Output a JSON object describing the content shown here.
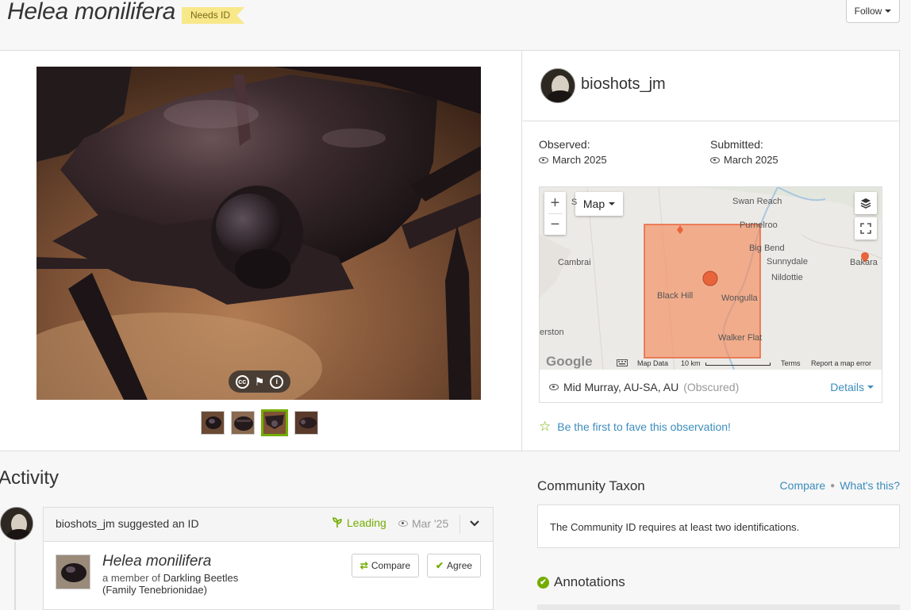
{
  "header": {
    "species": "Helea monilifera",
    "quality_badge": "Needs ID",
    "follow_label": "Follow"
  },
  "photo": {
    "thumbnails": 4,
    "active_thumbnail": 3
  },
  "observer": {
    "username": "bioshots_jm"
  },
  "dates": {
    "observed_label": "Observed:",
    "observed_value": "March 2025",
    "submitted_label": "Submitted:",
    "submitted_value": "March 2025"
  },
  "map": {
    "type_selector": "Map",
    "zoom_in": "+",
    "zoom_out": "−",
    "places": {
      "swan_reach": "Swan Reach",
      "purnelroo": "Purnelroo",
      "big_bend": "Big Bend",
      "cambrai": "Cambrai",
      "sunnydale": "Sunnydale",
      "nildottie": "Nildottie",
      "bakara": "Bakara",
      "black_hill": "Black Hill",
      "wongulla": "Wongulla",
      "walker_flat": "Walker Flat",
      "erston": "erston",
      "s_partial": "S"
    },
    "footer": {
      "google": "Google",
      "map_data": "Map Data",
      "scale": "10 km",
      "terms": "Terms",
      "report": "Report a map error"
    },
    "accent_color": "#f58a5c"
  },
  "location": {
    "name": "Mid Murray, AU-SA, AU",
    "privacy": "(Obscured)",
    "details_label": "Details"
  },
  "fave": {
    "label": "Be the first to fave this observation!"
  },
  "activity": {
    "title": "Activity",
    "identification": {
      "user": "bioshots_jm",
      "action": "suggested an ID",
      "status": "Leading",
      "date": "Mar '25",
      "taxon_name": "Helea monilifera",
      "member_prefix": "a member of",
      "parent_common": "Darkling Beetles",
      "parent_scientific": "(Family Tenebrionidae)",
      "compare_label": "Compare",
      "agree_label": "Agree"
    }
  },
  "community_taxon": {
    "title": "Community Taxon",
    "compare_link": "Compare",
    "whats_this_link": "What's this?",
    "message": "The Community ID requires at least two identifications."
  },
  "annotations": {
    "title": "Annotations"
  },
  "colors": {
    "brand_green": "#74ac00",
    "link_blue": "#3c8dbc",
    "badge_yellow": "#f8e88a"
  }
}
